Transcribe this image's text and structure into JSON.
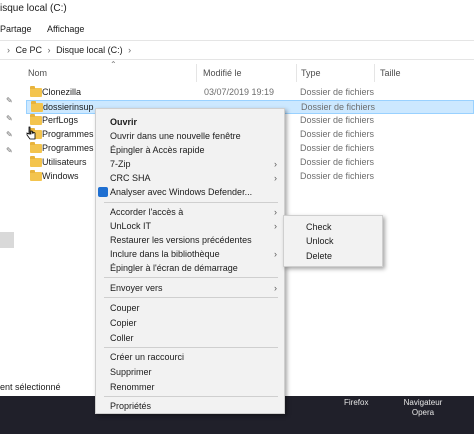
{
  "window": {
    "title": "isque local (C:)"
  },
  "ribbon": {
    "tabs": [
      "Partage",
      "Affichage"
    ]
  },
  "address": {
    "crumbs": [
      "Ce PC",
      "Disque local (C:)"
    ]
  },
  "columns": {
    "name": "Nom",
    "modified": "Modifié le",
    "type": "Type",
    "size": "Taille"
  },
  "files": [
    {
      "name": "Clonezilla",
      "date": "03/07/2019 19:19",
      "type": "Dossier de fichiers"
    },
    {
      "name": "dossierinsup",
      "date": "",
      "type": "Dossier de fichiers"
    },
    {
      "name": "PerfLogs",
      "date": "",
      "type": "Dossier de fichiers"
    },
    {
      "name": "Programmes",
      "date": "",
      "type": "Dossier de fichiers"
    },
    {
      "name": "Programmes",
      "date": "",
      "type": "Dossier de fichiers"
    },
    {
      "name": "Utilisateurs",
      "date": "",
      "type": "Dossier de fichiers"
    },
    {
      "name": "Windows",
      "date": "",
      "type": "Dossier de fichiers"
    }
  ],
  "status": {
    "text": "ent sélectionné"
  },
  "context_menu": {
    "open": "Ouvrir",
    "open_new_window": "Ouvrir dans une nouvelle fenêtre",
    "pin_quick": "Épingler à Accès rapide",
    "sevenzip": "7-Zip",
    "crc": "CRC SHA",
    "defender": "Analyser avec Windows Defender...",
    "grant_access": "Accorder l'accès à",
    "unlock": "UnLock IT",
    "restore": "Restaurer les versions précédentes",
    "include_library": "Inclure dans la bibliothèque",
    "pin_start": "Épingler à l'écran de démarrage",
    "send_to": "Envoyer vers",
    "cut": "Couper",
    "copy": "Copier",
    "paste": "Coller",
    "shortcut": "Créer un raccourci",
    "delete": "Supprimer",
    "rename": "Renommer",
    "properties": "Propriétés"
  },
  "submenu": {
    "check": "Check",
    "unlock": "Unlock",
    "delete": "Delete"
  },
  "taskbar": {
    "firefox": "Firefox",
    "opera_line1": "Navigateur",
    "opera_line2": "Opera"
  },
  "colors": {
    "selection": "#cce8ff",
    "folder": "#f3c44e",
    "taskbar": "#20202a"
  }
}
